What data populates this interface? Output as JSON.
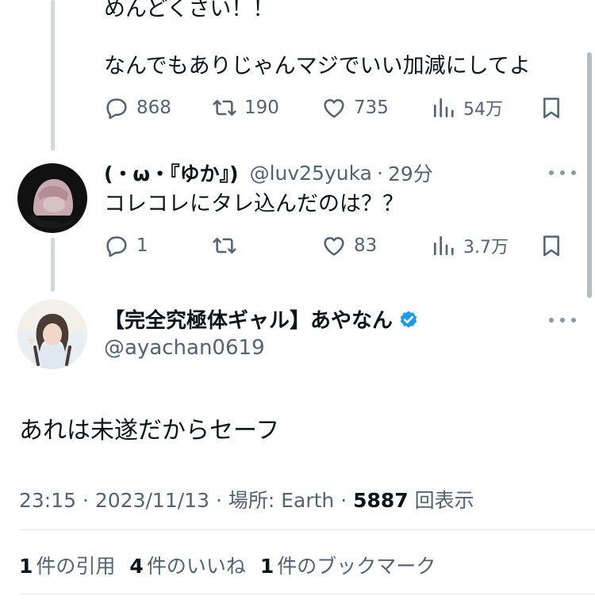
{
  "tweet1": {
    "text_line1": "めんどくさい！！",
    "text_line2": "なんでもありじゃんマジでいい加減にしてよ",
    "replies": "868",
    "retweets": "190",
    "likes": "735",
    "views": "54万"
  },
  "tweet2": {
    "display_name": "(・ω・『ゆか』)",
    "handle": "@luv25yuka",
    "time": "29分",
    "text": "コレコレにタレ込んだのは？？",
    "replies": "1",
    "retweets": "",
    "likes": "83",
    "views": "3.7万"
  },
  "main_tweet": {
    "display_name": "【完全究極体ギャル】あやなん",
    "handle": "@ayachan0619",
    "verified_color": "#1d9bf0",
    "text": "あれは未遂だからセーフ",
    "timestamp": "23:15 · 2023/11/13",
    "location_label": "場所: Earth",
    "views_count": "5887",
    "views_label": "回表示",
    "quotes_count": "1",
    "quotes_label": "件の引用",
    "likes_count": "4",
    "likes_label": "件のいいね",
    "bookmarks_count": "1",
    "bookmarks_label": "件のブックマーク"
  },
  "icons": [
    "reply-icon",
    "retweet-icon",
    "like-icon",
    "views-icon",
    "bookmark-icon",
    "more-icon",
    "verified-icon"
  ],
  "colors": {
    "text": "#0f1419",
    "secondary": "#536471",
    "thread_line": "#cfd9de",
    "verified": "#1d9bf0"
  }
}
